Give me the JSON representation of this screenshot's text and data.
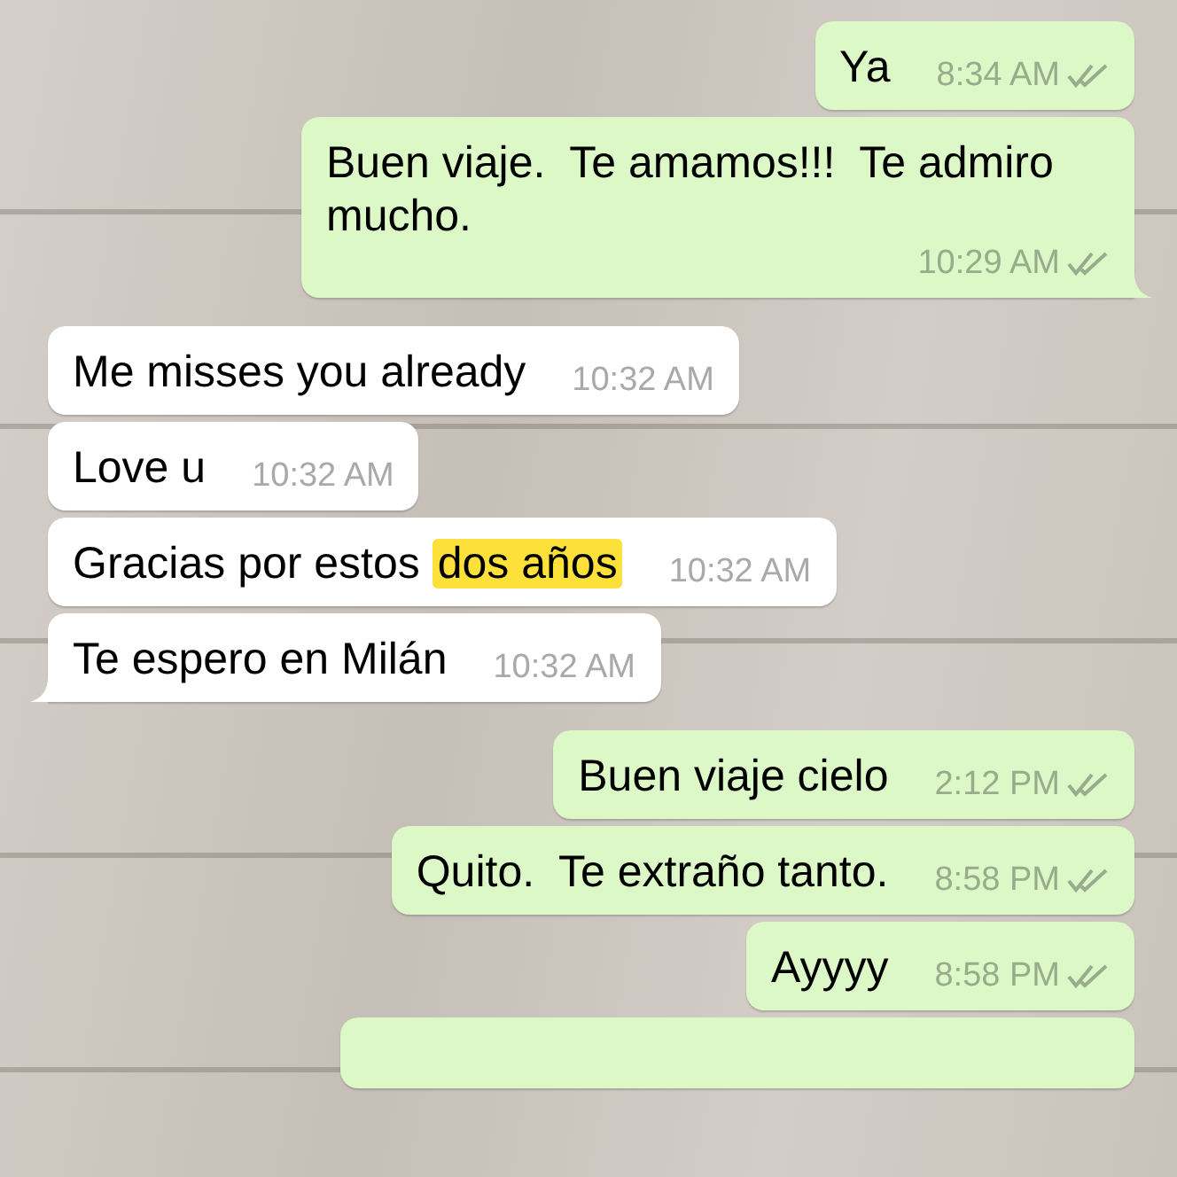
{
  "messages": [
    {
      "outgoing": true,
      "text": "Ya",
      "time": "8:34 AM",
      "read": false,
      "tail": false
    },
    {
      "outgoing": true,
      "text": "Buen viaje.  Te amamos!!!  Te admiro mucho.",
      "time": "10:29 AM",
      "read": false,
      "tail": true
    },
    {
      "outgoing": false,
      "text": "Me misses you already",
      "time": "10:32 AM",
      "tail": false
    },
    {
      "outgoing": false,
      "text": "Love u",
      "time": "10:32 AM",
      "tail": false
    },
    {
      "outgoing": false,
      "text": "Gracias por estos ",
      "highlight": "dos años",
      "time": "10:32 AM",
      "tail": false
    },
    {
      "outgoing": false,
      "text": "Te espero en Milán",
      "time": "10:32 AM",
      "tail": true
    },
    {
      "outgoing": true,
      "text": "Buen viaje cielo",
      "time": "2:12 PM",
      "read": false,
      "tail": false
    },
    {
      "outgoing": true,
      "text": "Quito.  Te extraño tanto.",
      "time": "8:58 PM",
      "read": false,
      "tail": false
    },
    {
      "outgoing": true,
      "text": "Ayyyy",
      "time": "8:58 PM",
      "read": false,
      "tail": false
    },
    {
      "outgoing": true,
      "kind": "cut-off",
      "tail": false
    }
  ]
}
